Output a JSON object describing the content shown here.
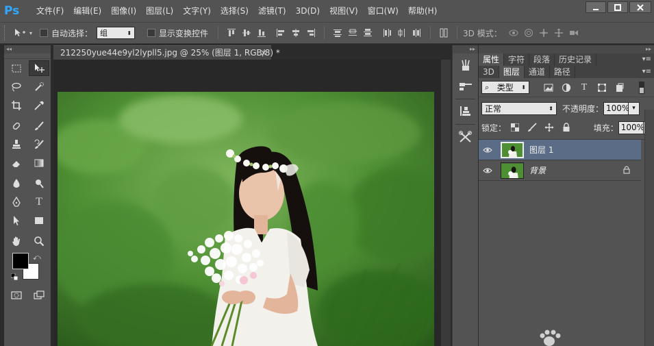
{
  "app": {
    "logo": "Ps"
  },
  "menu": [
    "文件(F)",
    "编辑(E)",
    "图像(I)",
    "图层(L)",
    "文字(Y)",
    "选择(S)",
    "滤镜(T)",
    "3D(D)",
    "视图(V)",
    "窗口(W)",
    "帮助(H)"
  ],
  "options": {
    "auto_select_label": "自动选择：",
    "auto_select_value": "组",
    "show_transform_label": "显示变换控件",
    "mode_3d_label": "3D 模式："
  },
  "document": {
    "tab_title": "212250yue44e9yl2lypll5.jpg @ 25% (图层 1, RGB/8) *",
    "close_glyph": "×"
  },
  "panels": {
    "top_tabs": [
      "属性",
      "字符",
      "段落",
      "历史记录"
    ],
    "layer_tabs": [
      "3D",
      "图层",
      "通道",
      "路径"
    ],
    "filter_kind": "类型",
    "blend_mode": "正常",
    "opacity_label": "不透明度：",
    "opacity_value": "100%",
    "lock_label": "锁定：",
    "fill_label": "填充：",
    "fill_value": "100%"
  },
  "layers": [
    {
      "name": "图层 1",
      "selected": true,
      "locked": false
    },
    {
      "name": "背景",
      "selected": false,
      "locked": true
    }
  ],
  "colors": {
    "foreground": "#000000",
    "background": "#ffffff",
    "accent": "#31a8ff",
    "selection": "#5b6c86"
  }
}
